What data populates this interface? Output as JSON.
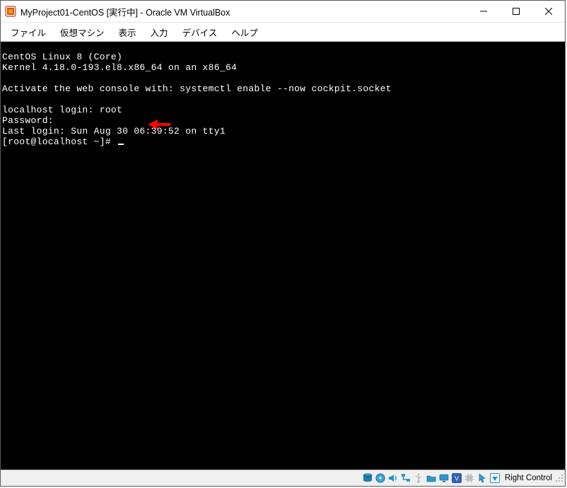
{
  "window": {
    "title": "MyProject01-CentOS [実行中] - Oracle VM VirtualBox"
  },
  "menu": {
    "file": "ファイル",
    "machine": "仮想マシン",
    "view": "表示",
    "input": "入力",
    "devices": "デバイス",
    "help": "ヘルプ"
  },
  "console": {
    "line1": "CentOS Linux 8 (Core)",
    "line2": "Kernel 4.18.0-193.el8.x86_64 on an x86_64",
    "blank": " ",
    "line3": "Activate the web console with: systemctl enable --now cockpit.socket",
    "login_prompt": "localhost login: ",
    "login_user": "root",
    "password_prompt": "Password:",
    "last_login": "Last login: Sun Aug 30 06:39:52 on tty1",
    "shell_prompt": "[root@localhost ~]# "
  },
  "statusbar": {
    "hostkey": "Right Control"
  },
  "icons": {
    "app": "virtualbox-icon",
    "min": "minimize-icon",
    "max": "maximize-icon",
    "close": "close-icon",
    "hdd": "hard-disk-icon",
    "opt": "optical-disc-icon",
    "aud": "audio-icon",
    "net": "network-icon",
    "usb": "usb-icon",
    "shf": "shared-folder-icon",
    "dsp": "display-icon",
    "rec": "recording-icon",
    "cpu": "cpu-icon",
    "mse": "mouse-integration-icon",
    "hkd": "hostkey-down-icon",
    "grip": "resize-grip-icon"
  }
}
